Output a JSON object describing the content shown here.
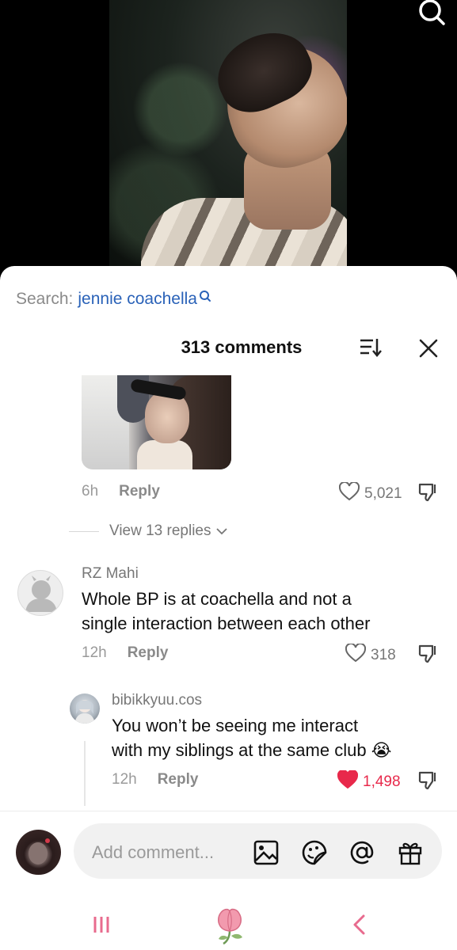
{
  "search": {
    "prefix": "Search:",
    "term": "jennie coachella"
  },
  "comments_header": {
    "count_label": "313 comments"
  },
  "first_comment": {
    "time": "6h",
    "reply_label": "Reply",
    "likes": "5,021"
  },
  "view_replies": {
    "label": "View 13 replies"
  },
  "comment_rz": {
    "username": "RZ Mahi",
    "text_line1": "Whole BP is at coachella and not a",
    "text_line2": "single interaction between each other",
    "time": "12h",
    "reply_label": "Reply",
    "likes": "318"
  },
  "reply_bibi": {
    "username": "bibikkyuu.cos",
    "text_line1": "You won’t be seeing me interact",
    "text_line2": "with my siblings at the same club 😭",
    "time": "12h",
    "reply_label": "Reply",
    "likes": "1,498",
    "liked": true
  },
  "composer": {
    "placeholder": "Add comment..."
  },
  "icons": [
    "search-icon",
    "sort-icon",
    "close-icon",
    "heart-icon",
    "dislike-icon",
    "chevron-down-icon",
    "image-icon",
    "sticker-icon",
    "mention-icon",
    "gift-icon",
    "recent-apps-icon",
    "home-flower-icon",
    "back-icon"
  ],
  "colors": {
    "link_blue": "#2a62b8",
    "liked_red": "#e8294b",
    "nav_pink": "#e86b8e"
  }
}
